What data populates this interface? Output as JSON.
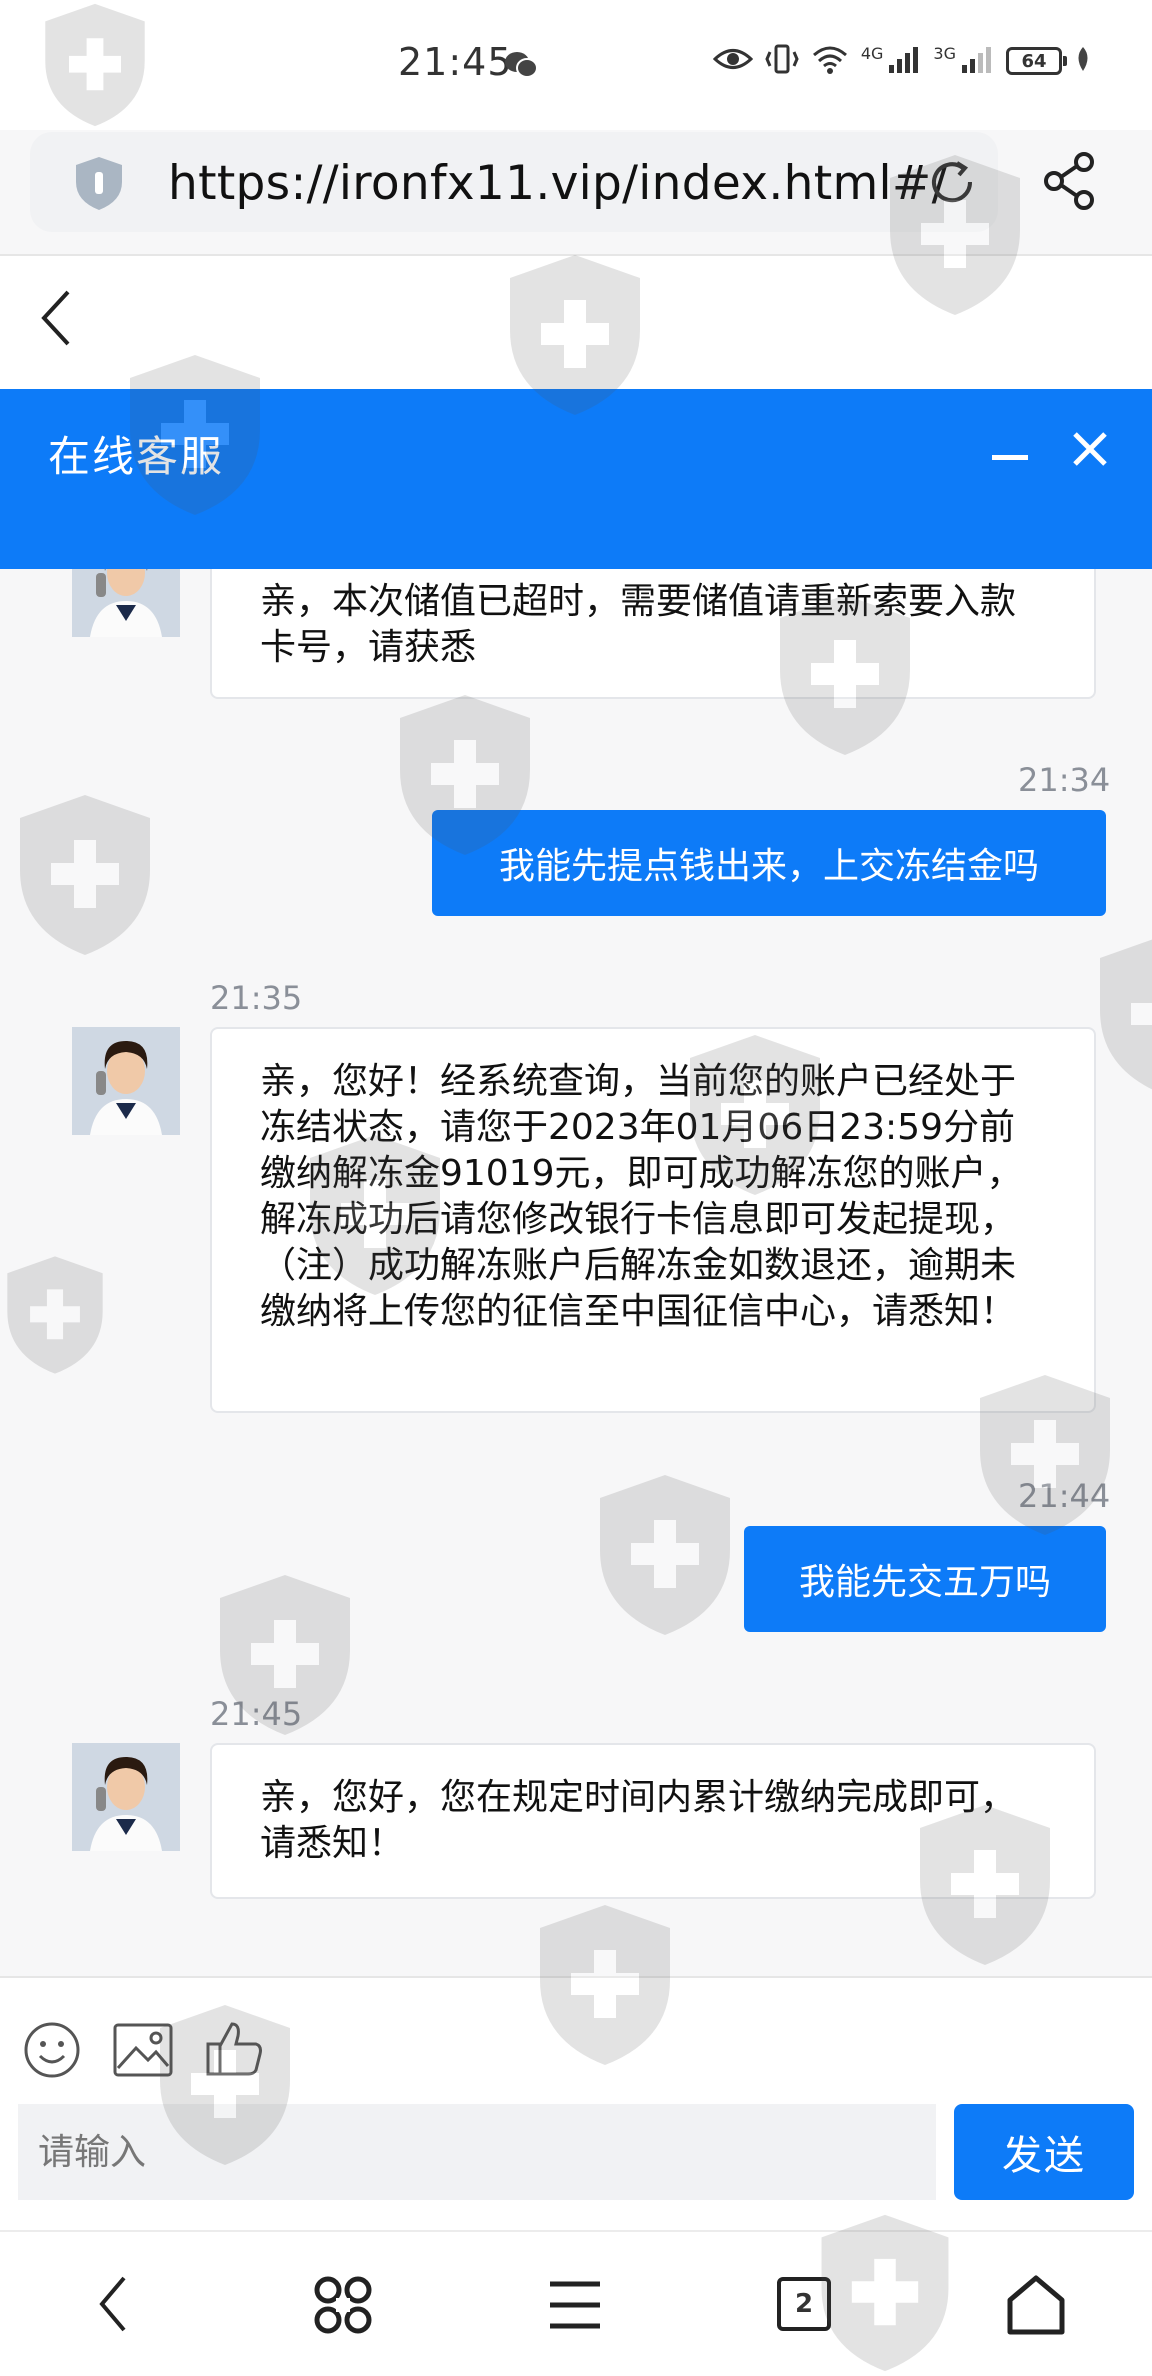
{
  "status_bar": {
    "time": "21:45",
    "network_1": "4G",
    "network_2": "3G",
    "battery": "64"
  },
  "browser": {
    "url": "https://ironfx11.vip/index.html#/",
    "tab_count": "2"
  },
  "chat": {
    "title": "在线客服",
    "messages": [
      {
        "from": "agent",
        "time": "",
        "text": "亲，本次储值已超时，需要储值请重新索要入款卡号，请获悉"
      },
      {
        "from": "user",
        "time": "21:34",
        "text": "我能先提点钱出来，上交冻结金吗"
      },
      {
        "from": "agent",
        "time": "21:35",
        "text": "亲，您好！经系统查询，当前您的账户已经处于冻结状态，请您于2023年01月06日23:59分前缴纳解冻金91019元，即可成功解冻您的账户，解冻成功后请您修改银行卡信息即可发起提现，（注）成功解冻账户后解冻金如数退还，逾期未缴纳将上传您的征信至中国征信中心，请悉知！"
      },
      {
        "from": "user",
        "time": "21:44",
        "text": "我能先交五万吗"
      },
      {
        "from": "agent",
        "time": "21:45",
        "text": "亲，您好，您在规定时间内累计缴纳完成即可，请悉知！"
      }
    ]
  },
  "input": {
    "placeholder": "请输入",
    "send_label": "发送"
  },
  "colors": {
    "accent": "#0d7bf8",
    "chat_background": "#f7f7f8",
    "timestamp": "#8a8f98"
  },
  "icons": [
    "chat-app-icon",
    "eye-icon",
    "vibrate-icon",
    "wifi-icon",
    "signal-icon",
    "battery-icon",
    "leaf-icon",
    "shield-icon",
    "reload-icon",
    "share-icon",
    "back-icon",
    "minimize-icon",
    "close-icon",
    "emoji-icon",
    "image-icon",
    "thumbs-up-icon",
    "nav-back-icon",
    "command-icon",
    "menu-icon",
    "tabs-icon",
    "home-icon",
    "watermark-shield-icon"
  ]
}
